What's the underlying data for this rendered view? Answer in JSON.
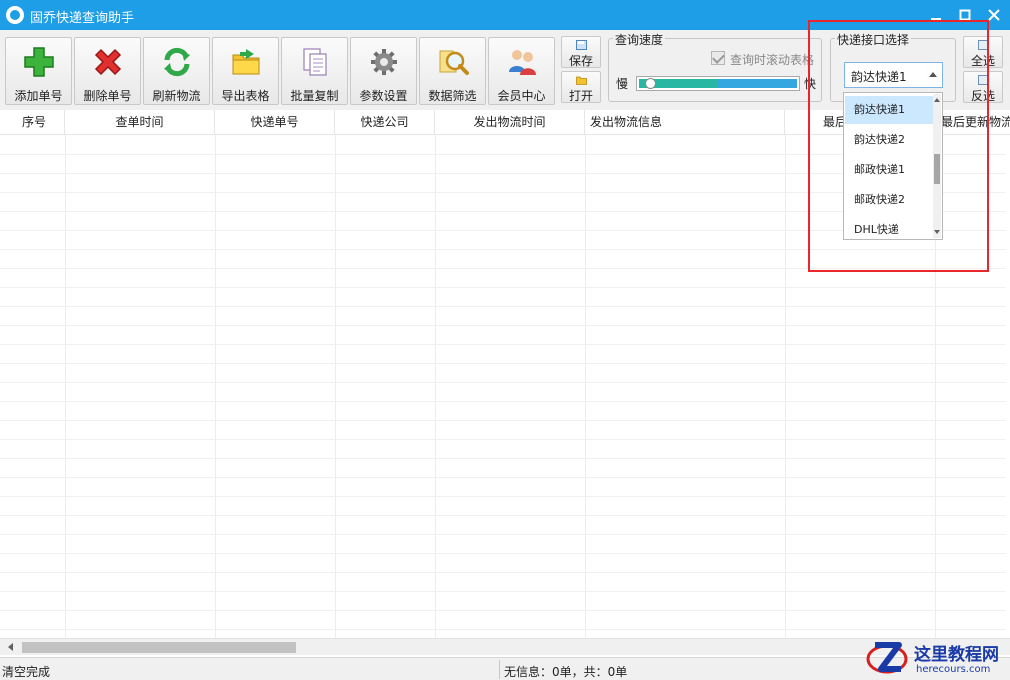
{
  "window": {
    "title": "固乔快递查询助手"
  },
  "toolbar": {
    "buttons": [
      {
        "label": "添加单号",
        "icon": "plus-icon"
      },
      {
        "label": "删除单号",
        "icon": "delete-x-icon"
      },
      {
        "label": "刷新物流",
        "icon": "refresh-icon"
      },
      {
        "label": "导出表格",
        "icon": "folder-export-icon"
      },
      {
        "label": "批量复制",
        "icon": "copy-pages-icon"
      },
      {
        "label": "参数设置",
        "icon": "gear-icon"
      },
      {
        "label": "数据筛选",
        "icon": "magnifier-icon"
      },
      {
        "label": "会员中心",
        "icon": "users-icon"
      }
    ],
    "save_label": "保存",
    "open_label": "打开",
    "speed": {
      "group_title": "查询速度",
      "scroll_checkbox_label": "查询时滚动表格",
      "slow_label": "慢",
      "fast_label": "快",
      "value": 0.5
    },
    "api": {
      "group_title": "快递接口选择",
      "selected": "韵达快递1",
      "options": [
        "韵达快递1",
        "韵达快递2",
        "邮政快递1",
        "邮政快递2",
        "DHL快递"
      ]
    },
    "select_all_label": "全选",
    "invert_label": "反选"
  },
  "table": {
    "columns": [
      "序号",
      "查单时间",
      "快递单号",
      "快递公司",
      "发出物流时间",
      "发出物流信息",
      "最后",
      "最后更新物流"
    ]
  },
  "status": {
    "left": "清空完成",
    "middle": "无信息：0单，共：0单"
  },
  "watermark": {
    "title": "这里教程网",
    "url": "herecours.com"
  },
  "colors": {
    "titlebar": "#1e9ee6",
    "highlight": "#e8262c",
    "selected_option": "#cce8ff",
    "slider_fill": "#27b7a2",
    "slider_rest": "#34a6e0"
  }
}
